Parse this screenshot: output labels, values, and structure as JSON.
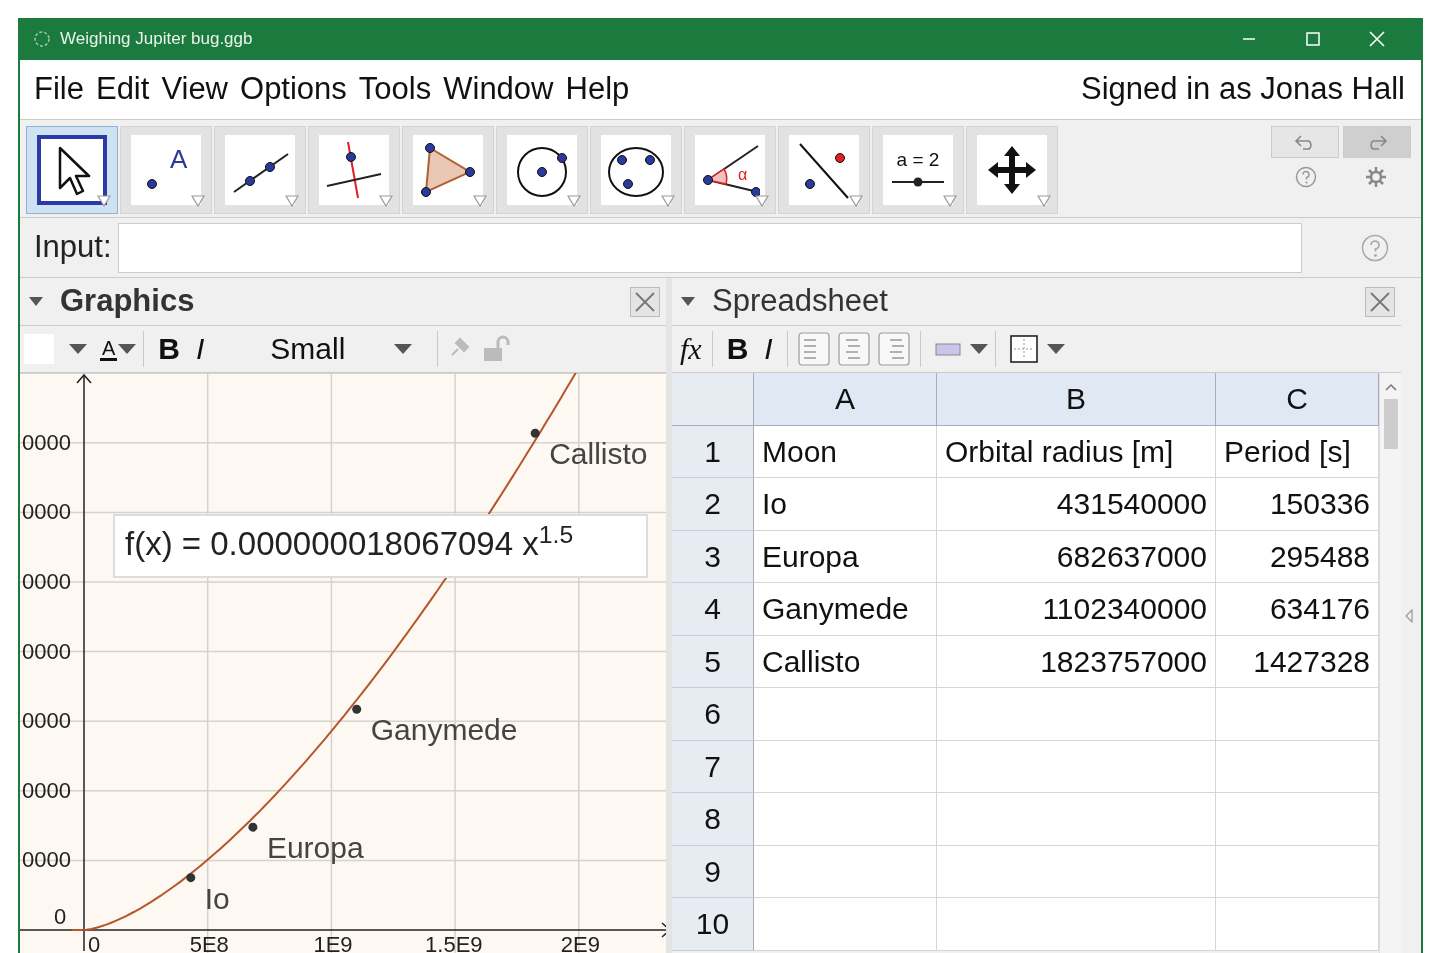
{
  "window": {
    "title": "Weighing Jupiter bug.ggb"
  },
  "menu": [
    {
      "label": "File"
    },
    {
      "label": "Edit"
    },
    {
      "label": "View"
    },
    {
      "label": "Options"
    },
    {
      "label": "Tools"
    },
    {
      "label": "Window"
    },
    {
      "label": "Help"
    }
  ],
  "signed_in": "Signed in as Jonas Hall",
  "tools": [
    {
      "kind": "move",
      "selected": true
    },
    {
      "kind": "point",
      "label": "A",
      "selected": false
    },
    {
      "kind": "line",
      "selected": false
    },
    {
      "kind": "perpendicular",
      "selected": false
    },
    {
      "kind": "polygon",
      "selected": false
    },
    {
      "kind": "circle",
      "selected": false
    },
    {
      "kind": "conic",
      "selected": false
    },
    {
      "kind": "angle",
      "label": "α",
      "selected": false
    },
    {
      "kind": "reflect",
      "selected": false
    },
    {
      "kind": "slider",
      "label": "a = 2",
      "selected": false
    },
    {
      "kind": "move_view",
      "selected": false
    }
  ],
  "input": {
    "label": "Input:"
  },
  "graphics": {
    "title": "Graphics",
    "style_bar": {
      "text_color_label": "A",
      "bold_label": "B",
      "italic_label": "I",
      "font_size": "Small"
    },
    "y_labels": [
      "0000",
      "0000",
      "0000",
      "0000",
      "0000",
      "0000",
      "0000",
      "0"
    ],
    "x_labels": [
      "0",
      "5E8",
      "1E9",
      "1.5E9",
      "2E9"
    ],
    "function_label": "f(x) = 0.000000018067094 x$^{1.5}$",
    "points": [
      {
        "label": "Io"
      },
      {
        "label": "Europa"
      },
      {
        "label": "Ganymede"
      },
      {
        "label": "Callisto"
      }
    ]
  },
  "spreadsheet": {
    "title": "Spreadsheet",
    "style_bar": {
      "formula_label": "fx",
      "bold_label": "B",
      "italic_label": "I"
    },
    "columns": [
      "A",
      "B",
      "C"
    ],
    "rows": [
      {
        "number": "1",
        "cells": [
          {
            "text": "Moon",
            "kind": "text"
          },
          {
            "text": "Orbital radius [m]",
            "kind": "text"
          },
          {
            "text": "Period [s]",
            "kind": "text"
          }
        ]
      },
      {
        "number": "2",
        "cells": [
          {
            "text": "Io",
            "kind": "text"
          },
          {
            "text": "431540000",
            "kind": "number"
          },
          {
            "text": "150336",
            "kind": "number"
          }
        ]
      },
      {
        "number": "3",
        "cells": [
          {
            "text": "Europa",
            "kind": "text"
          },
          {
            "text": "682637000",
            "kind": "number"
          },
          {
            "text": "295488",
            "kind": "number"
          }
        ]
      },
      {
        "number": "4",
        "cells": [
          {
            "text": "Ganymede",
            "kind": "text"
          },
          {
            "text": "1102340000",
            "kind": "number"
          },
          {
            "text": "634176",
            "kind": "number"
          }
        ]
      },
      {
        "number": "5",
        "cells": [
          {
            "text": "Callisto",
            "kind": "text"
          },
          {
            "text": "1823757000",
            "kind": "number"
          },
          {
            "text": "1427328",
            "kind": "number"
          }
        ]
      },
      {
        "number": "6"
      },
      {
        "number": "7"
      },
      {
        "number": "8"
      },
      {
        "number": "9"
      },
      {
        "number": "10"
      }
    ]
  }
}
